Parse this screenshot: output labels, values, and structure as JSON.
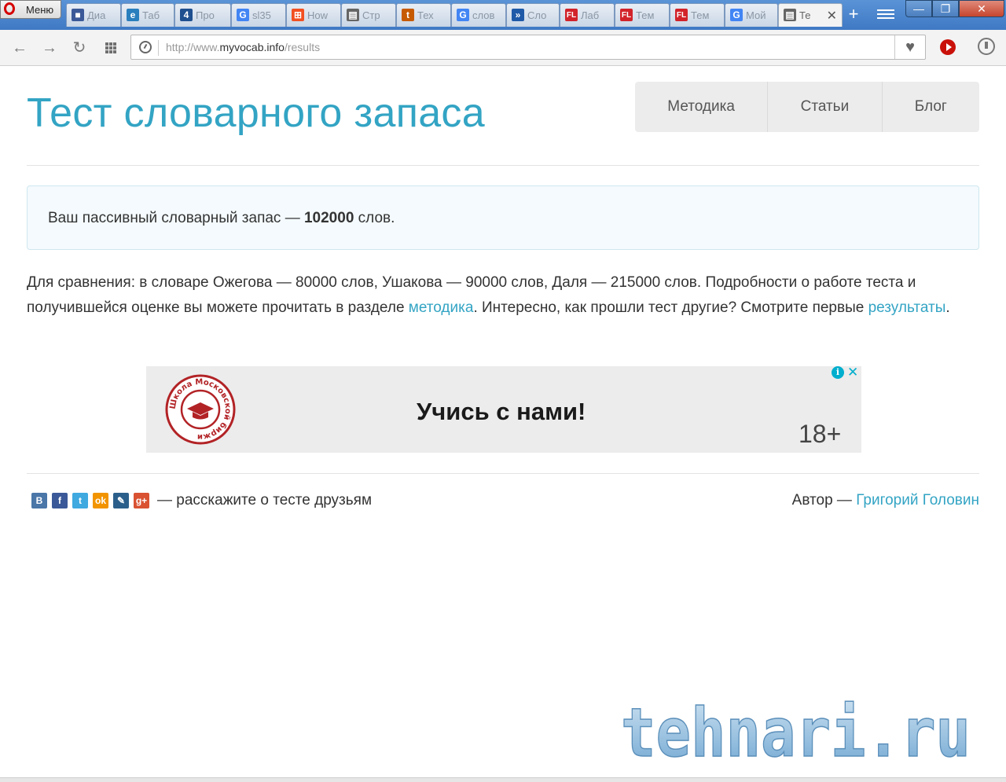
{
  "browser": {
    "menu_label": "Меню",
    "tabs": [
      {
        "label": "Диа",
        "icon": "speech-bubble-icon",
        "color": "#3b5998"
      },
      {
        "label": "Таб",
        "icon": "e-letter-icon",
        "color": "#2a7fbd"
      },
      {
        "label": "Про",
        "icon": "four-logo-icon",
        "color": "#1e4f8f"
      },
      {
        "label": "sl35",
        "icon": "google-g-icon",
        "color": "#4285f4"
      },
      {
        "label": "How",
        "icon": "windows-logo-icon",
        "color": "#f25022"
      },
      {
        "label": "Стр",
        "icon": "page-icon",
        "color": "#666666"
      },
      {
        "label": "Тех",
        "icon": "t-logo-icon",
        "color": "#c65a00"
      },
      {
        "label": "слов",
        "icon": "google-g-icon",
        "color": "#4285f4"
      },
      {
        "label": "Сло",
        "icon": "circle-arrows-icon",
        "color": "#1f5aa8"
      },
      {
        "label": "Лаб",
        "icon": "fl-logo-icon",
        "color": "#d2232a"
      },
      {
        "label": "Тем",
        "icon": "fl-logo-icon",
        "color": "#d2232a"
      },
      {
        "label": "Тем",
        "icon": "fl-logo-icon",
        "color": "#d2232a"
      },
      {
        "label": "Мой",
        "icon": "google-g-icon",
        "color": "#4285f4"
      },
      {
        "label": "Те",
        "icon": "page-icon",
        "color": "#666666",
        "active": true
      }
    ],
    "url_prefix": "http://www.",
    "url_domain": "myvocab.info",
    "url_path": "/results"
  },
  "header": {
    "title": "Тест словарного запаса",
    "nav": [
      "Методика",
      "Статьи",
      "Блог"
    ]
  },
  "result": {
    "prefix": "Ваш пассивный словарный запас — ",
    "value": "102000",
    "suffix": " слов."
  },
  "comparison": {
    "text1": "Для сравнения: в словаре Ожегова — 80000 слов, Ушакова — 90000 слов, Даля — 215000 слов. Подробности о работе теста и получившейся оценке вы можете прочитать в разделе ",
    "link1": "методика",
    "text2": ". Интересно, как прошли тест другие? Смотрите первые ",
    "link2": "результаты",
    "text3": "."
  },
  "ad": {
    "logo_text": "Школа Московской биржи",
    "slogan": "Учись с нами!",
    "age": "18+",
    "info_icon": "i"
  },
  "footer": {
    "share_icons": [
      {
        "name": "vk-icon",
        "glyph": "В",
        "color": "#4a76a8"
      },
      {
        "name": "facebook-icon",
        "glyph": "f",
        "color": "#3b5998"
      },
      {
        "name": "twitter-icon",
        "glyph": "t",
        "color": "#3fa9e0"
      },
      {
        "name": "odnoklassniki-icon",
        "glyph": "ok",
        "color": "#f29400"
      },
      {
        "name": "livejournal-icon",
        "glyph": "✎",
        "color": "#2b5f8b"
      },
      {
        "name": "google-plus-icon",
        "glyph": "g+",
        "color": "#d95232"
      }
    ],
    "share_text": "— расскажите о тесте друзьям",
    "author_label": "Автор — ",
    "author_name": "Григорий Головин"
  },
  "watermark": "tehnari.ru",
  "colors": {
    "accent": "#33a4c4",
    "result_bg": "#f4fafd",
    "nav_bg": "#ececec"
  }
}
